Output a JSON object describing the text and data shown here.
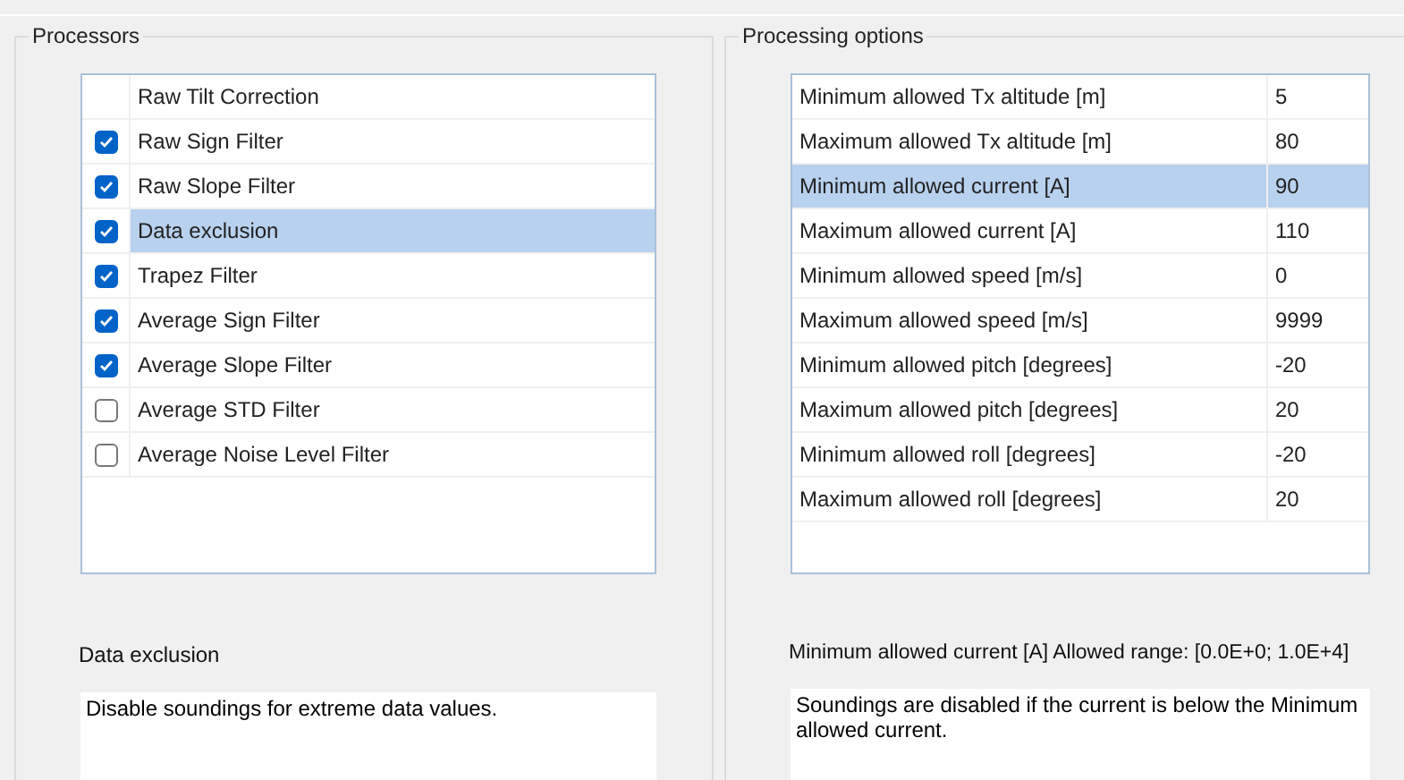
{
  "processors": {
    "title": "Processors",
    "items": [
      {
        "label": "Raw Tilt Correction",
        "kind": "plain",
        "selected": false
      },
      {
        "label": "Raw Sign Filter",
        "kind": "checkbox",
        "checked": true,
        "selected": false
      },
      {
        "label": "Raw Slope Filter",
        "kind": "checkbox",
        "checked": true,
        "selected": false
      },
      {
        "label": "Data exclusion",
        "kind": "checkbox",
        "checked": true,
        "selected": true
      },
      {
        "label": "Trapez Filter",
        "kind": "checkbox",
        "checked": true,
        "selected": false
      },
      {
        "label": "Average Sign Filter",
        "kind": "checkbox",
        "checked": true,
        "selected": false
      },
      {
        "label": "Average Slope Filter",
        "kind": "checkbox",
        "checked": true,
        "selected": false
      },
      {
        "label": "Average STD Filter",
        "kind": "checkbox",
        "checked": false,
        "selected": false
      },
      {
        "label": "Average Noise Level Filter",
        "kind": "checkbox",
        "checked": false,
        "selected": false
      }
    ],
    "description_label": "Data exclusion",
    "description": "Disable soundings for extreme data values."
  },
  "processing_options": {
    "title": "Processing options",
    "rows": [
      {
        "name": "Minimum allowed Tx altitude [m]",
        "value": "5",
        "selected": false
      },
      {
        "name": "Maximum allowed Tx altitude [m]",
        "value": "80",
        "selected": false
      },
      {
        "name": "Minimum allowed current [A]",
        "value": "90",
        "selected": true
      },
      {
        "name": "Maximum allowed current [A]",
        "value": "110",
        "selected": false
      },
      {
        "name": "Minimum allowed speed [m/s]",
        "value": "0",
        "selected": false
      },
      {
        "name": "Maximum allowed speed [m/s]",
        "value": "9999",
        "selected": false
      },
      {
        "name": "Minimum allowed pitch [degrees]",
        "value": "-20",
        "selected": false
      },
      {
        "name": "Maximum allowed pitch [degrees]",
        "value": "20",
        "selected": false
      },
      {
        "name": "Minimum allowed roll [degrees]",
        "value": "-20",
        "selected": false
      },
      {
        "name": "Maximum allowed roll [degrees]",
        "value": "20",
        "selected": false
      }
    ],
    "description_label": "Minimum allowed current [A] Allowed range:  [0.0E+0; 1.0E+4]",
    "description": "Soundings are disabled if the current is below the Minimum allowed current."
  }
}
